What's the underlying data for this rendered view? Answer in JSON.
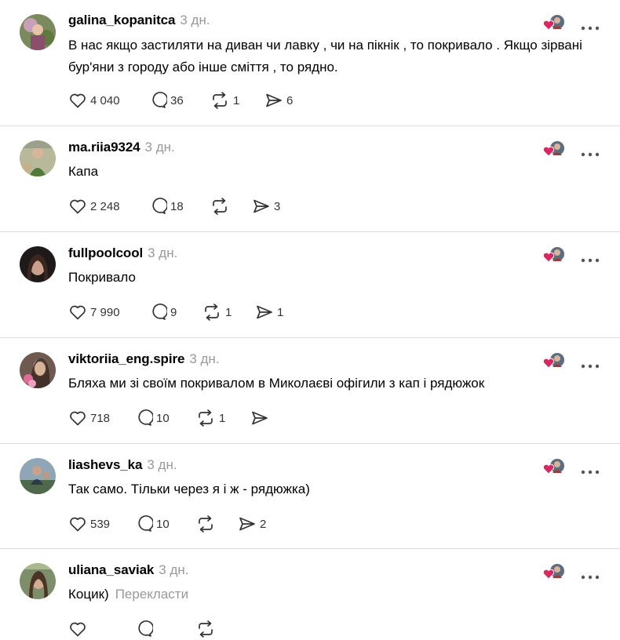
{
  "colors": {
    "text": "#000000",
    "muted": "#999999",
    "icon": "#333333",
    "divider": "#dcdcdc",
    "heart_red": "#e0245e"
  },
  "icons": {
    "like": "heart-icon",
    "reply": "comment-icon",
    "repost": "repost-icon",
    "share": "share-icon",
    "more": "more-icon",
    "liked_by": "liked-by-avatar-icon"
  },
  "comments": [
    {
      "username": "galina_kopanitca",
      "time": "3 дн.",
      "text": "В нас якщо застиляти на диван чи лавку , чи на пікнік , то покривало . Якщо зірвані бур'яни з городу або інше сміття , то рядно.",
      "likes": "4 040",
      "replies": "36",
      "reposts": "1",
      "shares": "6"
    },
    {
      "username": "ma.riia9324",
      "time": "3 дн.",
      "text": "Капа",
      "likes": "2 248",
      "replies": "18",
      "reposts": "",
      "shares": "3"
    },
    {
      "username": "fullpoolcool",
      "time": "3 дн.",
      "text": "Покривало",
      "likes": "7 990",
      "replies": "9",
      "reposts": "1",
      "shares": "1"
    },
    {
      "username": "viktoriia_eng.spire",
      "time": "3 дн.",
      "text": "Бляха ми зі своїм покривалом в Миколаєві офігили з кап і рядюжок",
      "likes": "718",
      "replies": "10",
      "reposts": "1",
      "shares": ""
    },
    {
      "username": "liashevs_ka",
      "time": "3 дн.",
      "text": "Так само. Тільки через я і ж - рядюжка)",
      "likes": "539",
      "replies": "10",
      "reposts": "",
      "shares": "2"
    },
    {
      "username": "uliana_saviak",
      "time": "3 дн.",
      "text": "Коцик)",
      "translate": "Перекласти"
    }
  ]
}
